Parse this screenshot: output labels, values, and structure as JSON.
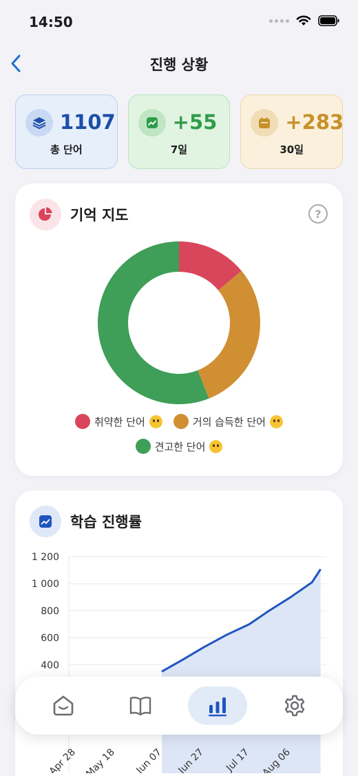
{
  "status_bar": {
    "time": "14:50"
  },
  "nav": {
    "title": "진행 상황"
  },
  "stats": [
    {
      "value": "1107",
      "label": "총 단어",
      "color": "#1d4ea8"
    },
    {
      "value": "+55",
      "label": "7일",
      "color": "#2f9c4b"
    },
    {
      "value": "+283",
      "label": "30일",
      "color": "#c7912a"
    }
  ],
  "memory_map": {
    "title": "기억 지도",
    "help": "?",
    "chart_data": {
      "type": "pie",
      "categories": [
        "취약한 단어",
        "거의 습득한 단어",
        "견고한 단어"
      ],
      "values": [
        14,
        30,
        56
      ],
      "colors": [
        "#d9465c",
        "#d08f33",
        "#3f9e58"
      ]
    },
    "legend": [
      {
        "label": "취약한 단어",
        "color": "#d9465c",
        "emoji": "neutral-face-emoji"
      },
      {
        "label": "거의 습득한 단어",
        "color": "#d08f33",
        "emoji": "grinning-face-emoji"
      },
      {
        "label": "견고한 단어",
        "color": "#3f9e58",
        "emoji": "star-struck-emoji"
      }
    ]
  },
  "progress": {
    "title": "학습 진행률",
    "chart_data": {
      "type": "area",
      "y_ticks": [
        "1 200",
        "1 000",
        "800",
        "600",
        "400"
      ],
      "ylim": [
        0,
        1200
      ],
      "x_ticks": [
        "Apr 28",
        "May 18",
        "Jun 07",
        "Jun 27",
        "Jul 17",
        "Aug 06"
      ],
      "series": [
        {
          "x": [
            "Jun 07",
            "Jun 17",
            "Jun 27",
            "Jul 07",
            "Jul 17",
            "Jul 27",
            "Aug 06",
            "Aug 16",
            "Aug 20"
          ],
          "values": [
            350,
            440,
            530,
            620,
            700,
            800,
            900,
            1010,
            1107
          ]
        }
      ],
      "line_color": "#1f55c0",
      "fill_color": "#dde6f6"
    }
  },
  "tabs": [
    {
      "name": "home",
      "active": false
    },
    {
      "name": "book",
      "active": false
    },
    {
      "name": "stats",
      "active": true
    },
    {
      "name": "settings",
      "active": false
    }
  ]
}
